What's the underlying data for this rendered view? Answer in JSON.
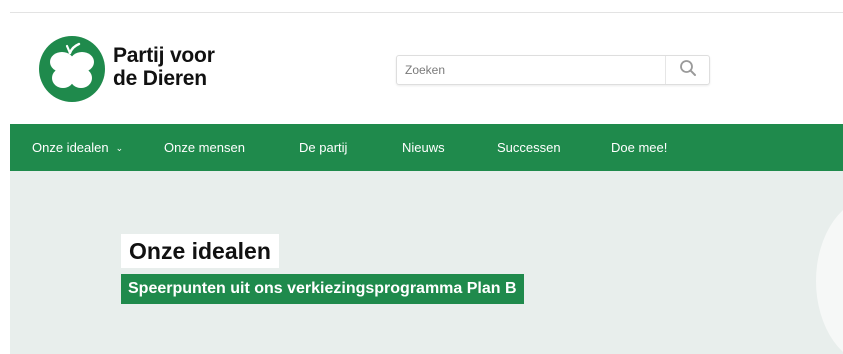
{
  "brand": {
    "name_line1": "Partij voor",
    "name_line2": "de Dieren",
    "logo_icon": "clover-leaf-logo-icon",
    "brand_green": "#1f8a4c"
  },
  "search": {
    "placeholder": "Zoeken",
    "value": "",
    "button_icon": "search-icon"
  },
  "nav": {
    "items": [
      {
        "label": "Onze idealen",
        "has_dropdown": true
      },
      {
        "label": "Onze mensen"
      },
      {
        "label": "De partij"
      },
      {
        "label": "Nieuws"
      },
      {
        "label": "Successen"
      },
      {
        "label": "Doe mee!"
      }
    ],
    "dropdown_icon": "chevron-down-icon"
  },
  "hero": {
    "title": "Onze idealen",
    "subtitle": "Speerpunten uit ons verkiezingsprogramma Plan B",
    "background_color": "#e8eeec"
  }
}
